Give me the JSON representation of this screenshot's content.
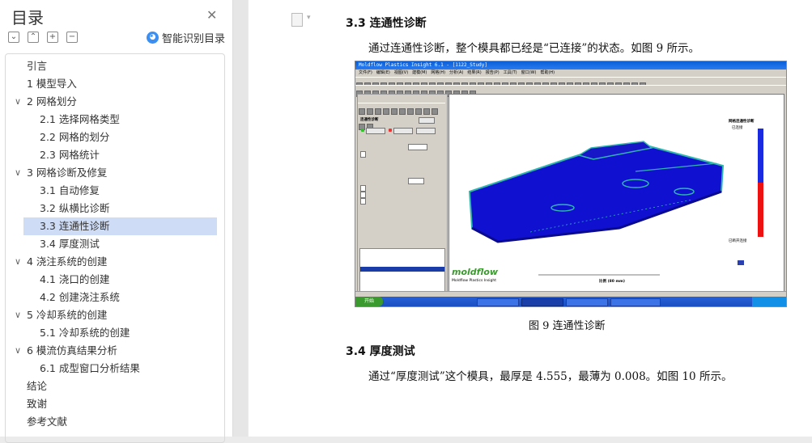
{
  "sidebar": {
    "title": "目录",
    "smart_toc_label": "智能识别目录",
    "items": [
      {
        "label": "引言",
        "level": 1,
        "expandable": false
      },
      {
        "label": "1 模型导入",
        "level": 1,
        "expandable": false
      },
      {
        "label": "2 网格划分",
        "level": 1,
        "expandable": true
      },
      {
        "label": "2.1  选择网格类型",
        "level": 2,
        "expandable": false
      },
      {
        "label": "2.2 网格的划分",
        "level": 2,
        "expandable": false
      },
      {
        "label": "2.3 网格统计",
        "level": 2,
        "expandable": false
      },
      {
        "label": "3 网格诊断及修复",
        "level": 1,
        "expandable": true
      },
      {
        "label": "3.1 自动修复",
        "level": 2,
        "expandable": false
      },
      {
        "label": "3.2 纵横比诊断",
        "level": 2,
        "expandable": false
      },
      {
        "label": "3.3 连通性诊断",
        "level": 2,
        "expandable": false,
        "selected": true
      },
      {
        "label": "3.4 厚度测试",
        "level": 2,
        "expandable": false
      },
      {
        "label": "4 浇注系统的创建",
        "level": 1,
        "expandable": true
      },
      {
        "label": "4.1 浇口的创建",
        "level": 2,
        "expandable": false
      },
      {
        "label": "4.2 创建浇注系统",
        "level": 2,
        "expandable": false
      },
      {
        "label": "5 冷却系统的创建",
        "level": 1,
        "expandable": true
      },
      {
        "label": "5.1 冷却系统的创建",
        "level": 2,
        "expandable": false
      },
      {
        "label": "6 模流仿真结果分析",
        "level": 1,
        "expandable": true
      },
      {
        "label": "6.1 成型窗口分析结果",
        "level": 2,
        "expandable": false
      },
      {
        "label": "结论",
        "level": 1,
        "expandable": false
      },
      {
        "label": "致谢",
        "level": 1,
        "expandable": false
      },
      {
        "label": "参考文献",
        "level": 1,
        "expandable": false
      }
    ]
  },
  "document": {
    "section_33_title": "3.3 连通性诊断",
    "section_33_text": "通过连通性诊断，整个模具都已经是“已连接”的状态。如图 9 所示。",
    "figure9_caption": "图 9  连通性诊断",
    "section_34_title": "3.4 厚度测试",
    "section_34_text": "通过“厚度测试”这个模具，最厚是 4.555，最薄为 0.008。如图 10 所示。"
  },
  "screenshot": {
    "window_title": "Moldflow Plastics Insight 6.1 - [1122_Study]",
    "panel_title": "连通性诊断",
    "legend_title": "网格连通性诊断",
    "legend_top": "已连接",
    "legend_bottom": "已断开连接",
    "brand": "moldflow",
    "brand_sub": "Moldflow Plastics Insight",
    "scale_label": "比例 (80 mm)",
    "start_label": "开始",
    "colors": {
      "mesh": "#1010d0",
      "accent": "#2fb8b0",
      "connected": "#1a2ae0",
      "disconnected": "#ee1111"
    }
  }
}
